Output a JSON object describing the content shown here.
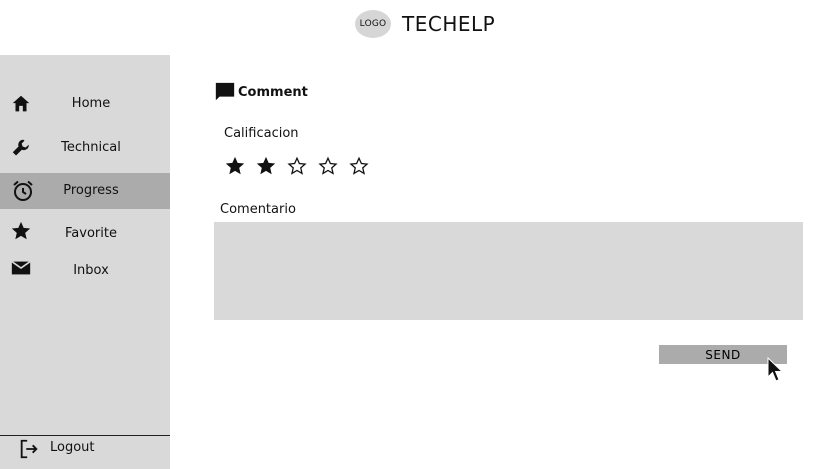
{
  "header": {
    "logo_text": "LOGO",
    "title": "TECHELP"
  },
  "sidebar": {
    "items": [
      {
        "label": "Home",
        "icon": "home-icon"
      },
      {
        "label": "Technical",
        "icon": "wrench-icon"
      },
      {
        "label": "Progress",
        "icon": "alarm-clock-icon",
        "active": true
      },
      {
        "label": "Favorite",
        "icon": "star-icon"
      },
      {
        "label": "Inbox",
        "icon": "envelope-icon"
      }
    ],
    "logout_label": "Logout"
  },
  "main": {
    "section_title": "Comment",
    "rating_label": "Calificacion",
    "rating": {
      "value": 2,
      "max": 5
    },
    "comment_label": "Comentario",
    "comment_value": "",
    "send_label": "SEND"
  }
}
